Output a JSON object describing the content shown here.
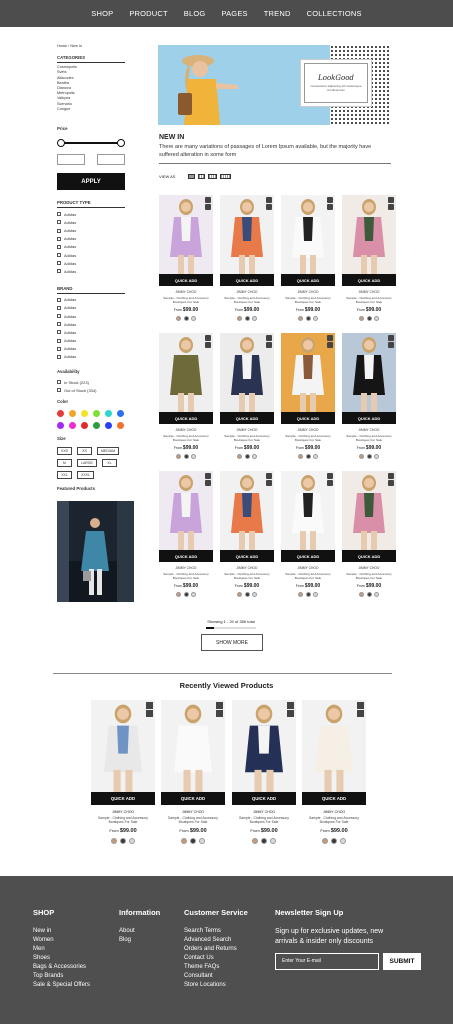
{
  "nav": [
    "SHOP",
    "PRODUCT",
    "BLOG",
    "PAGES",
    "TREND",
    "COLLECTIONS"
  ],
  "breadcrumb": "Home / New In",
  "sidebar": {
    "categories_title": "CATEGORIES",
    "categories": [
      "Cosmopolis",
      "Svets",
      "Alfacodex",
      "Bealtra",
      "Dianova",
      "Metropolis",
      "Valkyria",
      "Scenario",
      "Congue"
    ],
    "price_title": "Price",
    "apply": "APPLY",
    "product_type_title": "PRODUCT TYPE",
    "product_types": [
      "Adidas",
      "Adidas",
      "Adidas",
      "Adidas",
      "Adidas",
      "Adidas",
      "Adidas",
      "Adidas"
    ],
    "brand_title": "BRAND",
    "brands": [
      "Adidas",
      "Adidas",
      "Adidas",
      "Adidas",
      "Adidas",
      "Adidas",
      "Adidas",
      "Adidas"
    ],
    "availability_title": "Availability",
    "availability": [
      "In Stock (223)",
      "Out of Stock (334)"
    ],
    "color_title": "Color",
    "colors": [
      "#e63b3b",
      "#f2a52b",
      "#f2e22b",
      "#7fe034",
      "#2bd6d1",
      "#2b6ff2",
      "#a12bf2",
      "#f22bd0",
      "#e02b2b",
      "#2b9c3f",
      "#2b3ff2",
      "#f2712b"
    ],
    "size_title": "Size",
    "sizes": [
      "XXS",
      "XS",
      "MEDIUM",
      "M",
      "LARGE",
      "XL",
      "XXL",
      "XXXL"
    ],
    "featured_title": "Featured Products"
  },
  "hero": {
    "logo": "LookGood",
    "tagline": "Consectetur adipiscing elit scelerisque condimentum"
  },
  "newin": {
    "title": "NEW IN",
    "desc": "There are many variations of passages of Lorem Ipsum available, but the majority have suffered alteration in some form"
  },
  "view_as": "VIEW AS",
  "product": {
    "quick_add": "QUICK ADD",
    "brand": "JIMMY CHOO",
    "name": "Sample - Clothing and Accessory Boutiques For Sale",
    "from": "From",
    "price": "$99.00"
  },
  "products": [
    {
      "bg": "#efe9f2",
      "c1": "#c9a4db",
      "c2": "#f4f4f4"
    },
    {
      "bg": "#f1f1f1",
      "c1": "#e87a4a",
      "c2": "#3a4d7a"
    },
    {
      "bg": "#f3f3f3",
      "c1": "#fafafa",
      "c2": "#222222"
    },
    {
      "bg": "#f0ebe6",
      "c1": "#d98fa7",
      "c2": "#3d5b3a"
    },
    {
      "bg": "#efefef",
      "c1": "#6e6a3a",
      "c2": "#6e6a3a"
    },
    {
      "bg": "#ececec",
      "c1": "#2a3452",
      "c2": "#f4f4f4"
    },
    {
      "bg": "#e8a84a",
      "c1": "#f4f4f4",
      "c2": "#8a5a3a"
    },
    {
      "bg": "#b9c8d8",
      "c1": "#151515",
      "c2": "#f4f4f4"
    },
    {
      "bg": "#efe9f2",
      "c1": "#c9a4db",
      "c2": "#f4f4f4"
    },
    {
      "bg": "#f1f1f1",
      "c1": "#e87a4a",
      "c2": "#3a4d7a"
    },
    {
      "bg": "#f3f3f3",
      "c1": "#fafafa",
      "c2": "#222222"
    },
    {
      "bg": "#f0ebe6",
      "c1": "#d98fa7",
      "c2": "#3d5b3a"
    }
  ],
  "swatches": [
    "#c79a7a",
    "#3a3a3a",
    "#d9d9d9"
  ],
  "showing": "Showing 1 - 20 of 356 total",
  "progress": 0.15,
  "show_more": "SHOW MORE",
  "recent_title": "Recently Viewed Products",
  "recent": [
    {
      "bg": "#f2f2f2",
      "c1": "#e8e8e8",
      "c2": "#6f93c4"
    },
    {
      "bg": "#f2f2f2",
      "c1": "#fafafa",
      "c2": "#fafafa"
    },
    {
      "bg": "#f2f2f2",
      "c1": "#253056",
      "c2": "#f4f4f4"
    },
    {
      "bg": "#f2f2f2",
      "c1": "#f5efe6",
      "c2": "#f5efe6"
    }
  ],
  "footer": {
    "shop_title": "SHOP",
    "shop": [
      "New in",
      "Women",
      "Men",
      "Shoes",
      "Bags & Accessories",
      "Top Brands",
      "Sale & Special Offers"
    ],
    "info_title": "Information",
    "info": [
      "About",
      "Blog"
    ],
    "cs_title": "Customer Service",
    "cs": [
      "Search Terms",
      "Advanced Search",
      "Orders and Returns",
      "Contact Us",
      "Theme FAQs",
      "Consultant",
      "Store Locations"
    ],
    "nl_title": "Newsletter Sign Up",
    "nl_text": "Sign up for exclusive updates, new arrivals & insider only discounts",
    "nl_placeholder": "Enter Your E-mail",
    "nl_button": "SUBMIT"
  }
}
